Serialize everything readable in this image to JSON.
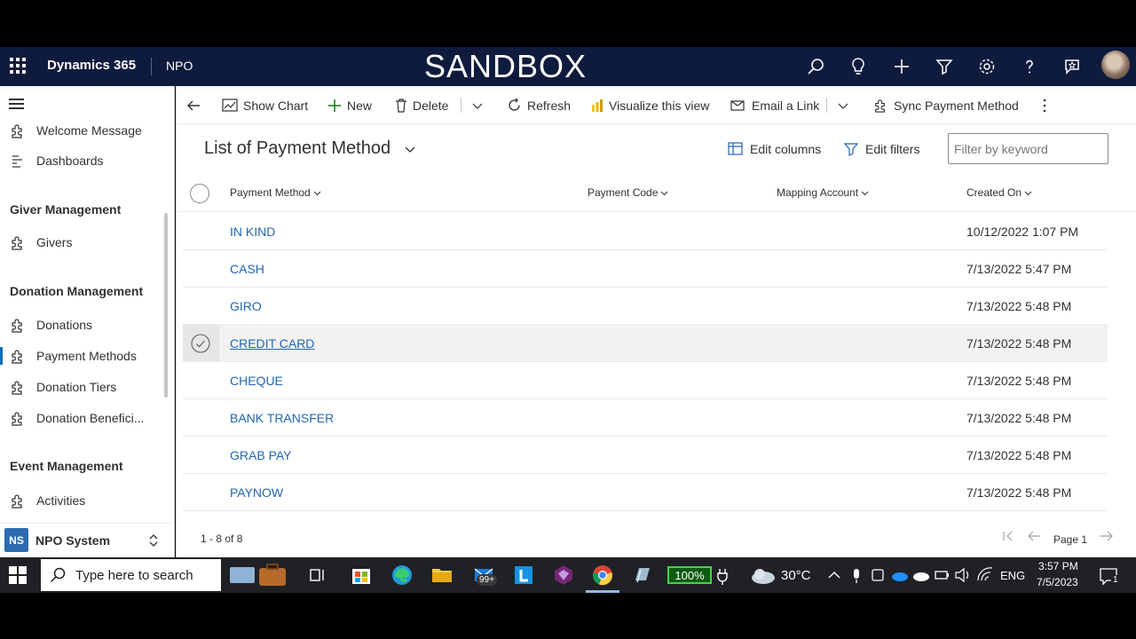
{
  "topbar": {
    "app_title": "Dynamics 365",
    "app_name": "NPO",
    "environment": "SANDBOX"
  },
  "sidebar": {
    "items_top": [
      {
        "label": "Welcome Message"
      },
      {
        "label": "Dashboards"
      }
    ],
    "groups": [
      {
        "title": "Giver Management",
        "items": [
          {
            "label": "Givers"
          }
        ]
      },
      {
        "title": "Donation Management",
        "items": [
          {
            "label": "Donations"
          },
          {
            "label": "Payment Methods",
            "active": true
          },
          {
            "label": "Donation Tiers"
          },
          {
            "label": "Donation Benefici..."
          }
        ]
      },
      {
        "title": "Event Management",
        "items": [
          {
            "label": "Activities"
          }
        ]
      }
    ],
    "area": {
      "badge": "NS",
      "name": "NPO System"
    }
  },
  "commandbar": {
    "show_chart": "Show Chart",
    "new": "New",
    "delete": "Delete",
    "refresh": "Refresh",
    "visualize": "Visualize this view",
    "email_link": "Email a Link",
    "sync": "Sync Payment Method"
  },
  "view": {
    "title": "List of Payment Method",
    "edit_columns": "Edit columns",
    "edit_filters": "Edit filters",
    "filter_placeholder": "Filter by keyword"
  },
  "grid": {
    "columns": [
      "Payment Method",
      "Payment Code",
      "Mapping Account",
      "Created On"
    ],
    "rows": [
      {
        "name": "IN KIND",
        "created": "10/12/2022 1:07 PM"
      },
      {
        "name": "CASH",
        "created": "7/13/2022 5:47 PM"
      },
      {
        "name": "GIRO",
        "created": "7/13/2022 5:48 PM"
      },
      {
        "name": "CREDIT CARD",
        "created": "7/13/2022 5:48 PM",
        "selected": true
      },
      {
        "name": "CHEQUE",
        "created": "7/13/2022 5:48 PM"
      },
      {
        "name": "BANK TRANSFER",
        "created": "7/13/2022 5:48 PM"
      },
      {
        "name": "GRAB PAY",
        "created": "7/13/2022 5:48 PM"
      },
      {
        "name": "PAYNOW",
        "created": "7/13/2022 5:48 PM"
      }
    ],
    "count_text": "1 - 8 of 8",
    "page_label": "Page 1"
  },
  "taskbar": {
    "search_text": "Type here to search",
    "mail_badge": "99+",
    "battery": "100%",
    "weather": "30°C",
    "language": "ENG",
    "time": "3:57 PM",
    "date": "7/5/2023",
    "notif_count": "1"
  },
  "colors": {
    "nav_bg": "#0f1b3d",
    "link": "#2266b0",
    "taskbar": "#1f2125"
  }
}
